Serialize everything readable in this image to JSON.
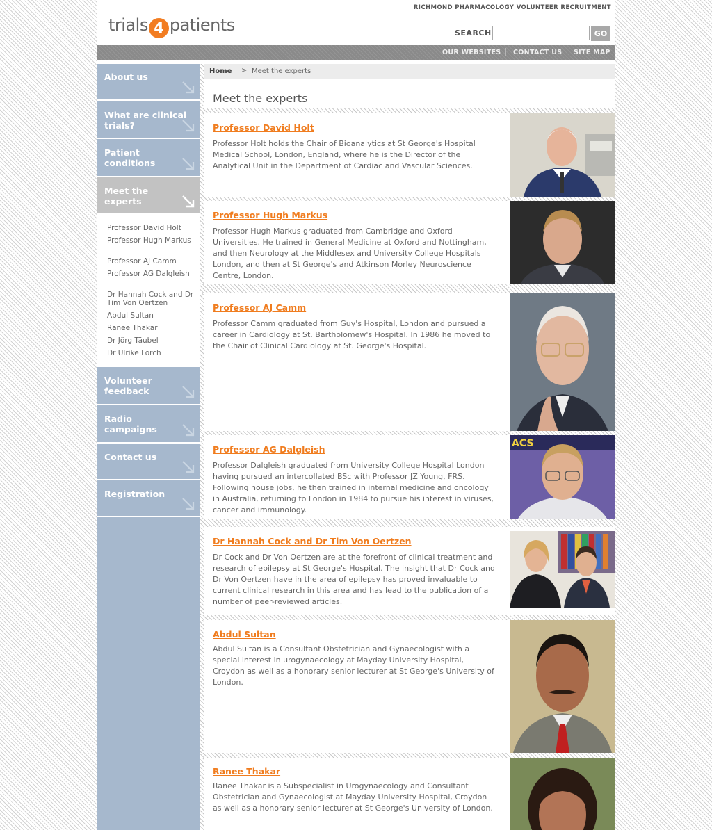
{
  "header": {
    "tagline": "RICHMOND PHARMACOLOGY VOLUNTEER RECRUITMENT",
    "logo": {
      "pre": "trials",
      "num": "4",
      "post": "patients"
    },
    "search_label": "SEARCH",
    "search_value": "",
    "go_label": "GO"
  },
  "topnav": [
    "OUR WEBSITES",
    "CONTACT US",
    "SITE MAP"
  ],
  "sidebar": {
    "items": [
      {
        "label": "About us"
      },
      {
        "label": "What are clinical trials?"
      },
      {
        "label": "Patient conditions"
      },
      {
        "label": "Meet the experts"
      },
      {
        "label": "Volunteer feedback"
      },
      {
        "label": "Radio campaigns"
      },
      {
        "label": "Contact us"
      },
      {
        "label": "Registration"
      }
    ],
    "subitems": [
      "Professor David Holt",
      "Professor Hugh Markus",
      "Professor AJ Camm",
      "Professor AG Dalgleish",
      "Dr Hannah Cock and Dr Tim Von Oertzen",
      "Abdul Sultan",
      "Ranee Thakar",
      "Dr Jörg Täubel",
      "Dr Ulrike Lorch"
    ]
  },
  "breadcrumb": {
    "home": "Home",
    "separator": ">",
    "current": "Meet the experts"
  },
  "page_title": "Meet the experts",
  "experts": [
    {
      "name": "Professor David Holt",
      "bio": "Professor Holt holds the Chair of Bioanalytics at St George's Hospital Medical School, London, England, where he is the Director of the Analytical Unit in the Department of Cardiac and Vascular Sciences."
    },
    {
      "name": "Professor Hugh Markus",
      "bio": "Professor Hugh Markus graduated from Cambridge and Oxford Universities. He trained in General Medicine at Oxford and Nottingham, and then Neurology at the Middlesex and University College Hospitals London, and then at St George's and Atkinson Morley Neuroscience Centre, London."
    },
    {
      "name": "Professor AJ Camm",
      "bio": "Professor Camm graduated from Guy's Hospital, London and pursued a career in Cardiology at St. Bartholomew's Hospital. In 1986 he moved to the Chair of Clinical Cardiology at St. George's Hospital."
    },
    {
      "name": "Professor AG Dalgleish",
      "bio": "Professor Dalgleish graduated from University College Hospital London having pursued an intercollated BSc with Professor JZ Young, FRS. Following house jobs, he then trained in internal medicine and oncology in Australia, returning to London in 1984 to pursue his interest in viruses, cancer and immunology."
    },
    {
      "name": "Dr Hannah Cock and Dr Tim Von Oertzen",
      "bio": "Dr Cock and Dr Von Oertzen are at the forefront of clinical treatment and research of epilepsy at St George's Hospital. The insight that Dr Cock and Dr Von Oertzen have in the area of epilepsy has proved invaluable to current clinical research in this area and has lead to the publication of a number of peer-reviewed articles."
    },
    {
      "name": "Abdul Sultan",
      "bio": "Abdul Sultan is a Consultant Obstetrician and Gynaecologist with a special interest in urogynaecology at Mayday University Hospital, Croydon as well as a honorary senior lecturer at St George's University of London."
    },
    {
      "name": "Ranee Thakar",
      "bio": "Ranee Thakar is a Subspecialist in Urogynaecology and Consultant Obstetrician and Gynaecologist at Mayday University Hospital, Croydon as well as a honorary senior lecturer at St George's University of London."
    }
  ],
  "photo_sign_text": "ACS",
  "colors": {
    "accent": "#f07c1e",
    "sidebar": "#a6b8cd",
    "active_nav": "#c2c2c2",
    "topbar": "#8a8a8a"
  }
}
